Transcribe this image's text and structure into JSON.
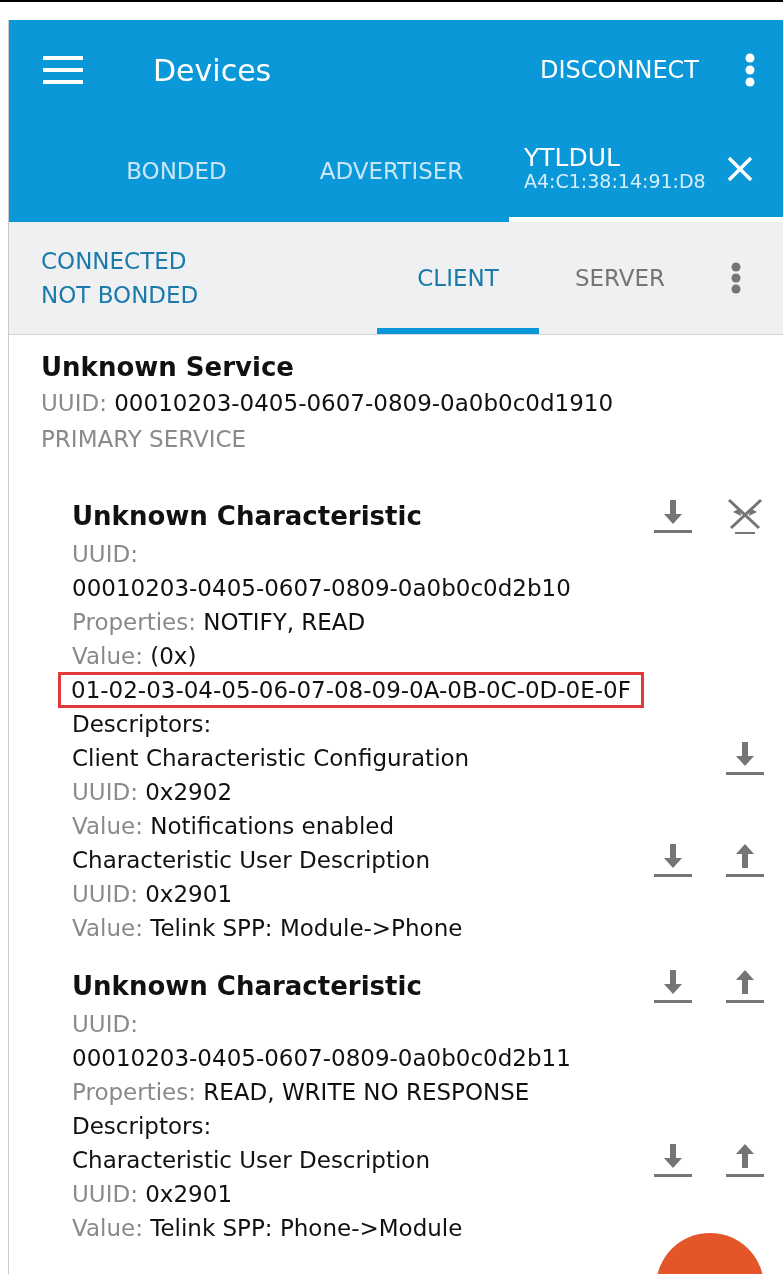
{
  "app_bar": {
    "title": "Devices",
    "action": "DISCONNECT"
  },
  "tabs": [
    {
      "label": "BONDED",
      "selected": false
    },
    {
      "label": "ADVERTISER",
      "selected": false
    },
    {
      "label": "YTLDUL",
      "address": "A4:C1:38:14:91:D8",
      "selected": true
    }
  ],
  "connection": {
    "status": "CONNECTED",
    "bond": "NOT BONDED"
  },
  "sub_tabs": [
    {
      "label": "CLIENT",
      "selected": true
    },
    {
      "label": "SERVER",
      "selected": false
    }
  ],
  "service": {
    "name": "Unknown Service",
    "uuid_label": "UUID:",
    "uuid": "00010203-0405-0607-0809-0a0b0c0d1910",
    "type": "PRIMARY SERVICE"
  },
  "characteristics": [
    {
      "name": "Unknown Characteristic",
      "actions": [
        {
          "kind": "read"
        },
        {
          "kind": "notify_off"
        }
      ],
      "lines": [
        {
          "label": "UUID:"
        },
        {
          "value": "00010203-0405-0607-0809-0a0b0c0d2b10"
        },
        {
          "label": "Properties:",
          "value": "NOTIFY, READ"
        },
        {
          "label": "Value:",
          "value": "(0x)"
        },
        {
          "value": "01-02-03-04-05-06-07-08-09-0A-0B-0C-0D-0E-0F",
          "highlighted": true
        },
        {
          "value": "Descriptors:"
        },
        {
          "value": "Client Characteristic Configuration",
          "actions": [
            {
              "kind": "read"
            }
          ]
        },
        {
          "label": "UUID:",
          "value": "0x2902"
        },
        {
          "label": "Value:",
          "value": "Notifications enabled"
        },
        {
          "value": "Characteristic User Description",
          "actions": [
            {
              "kind": "read"
            },
            {
              "kind": "write"
            }
          ]
        },
        {
          "label": "UUID:",
          "value": "0x2901"
        },
        {
          "label": "Value:",
          "value": "Telink SPP: Module->Phone"
        }
      ]
    },
    {
      "name": "Unknown Characteristic",
      "actions": [
        {
          "kind": "read"
        },
        {
          "kind": "write"
        }
      ],
      "lines": [
        {
          "label": "UUID:"
        },
        {
          "value": "00010203-0405-0607-0809-0a0b0c0d2b11"
        },
        {
          "label": "Properties:",
          "value": "READ, WRITE NO RESPONSE"
        },
        {
          "value": "Descriptors:"
        },
        {
          "value": "Characteristic User Description",
          "actions": [
            {
              "kind": "read"
            },
            {
              "kind": "write"
            }
          ]
        },
        {
          "label": "UUID:",
          "value": "0x2901"
        },
        {
          "label": "Value:",
          "value": "Telink SPP: Phone->Module"
        }
      ]
    }
  ]
}
